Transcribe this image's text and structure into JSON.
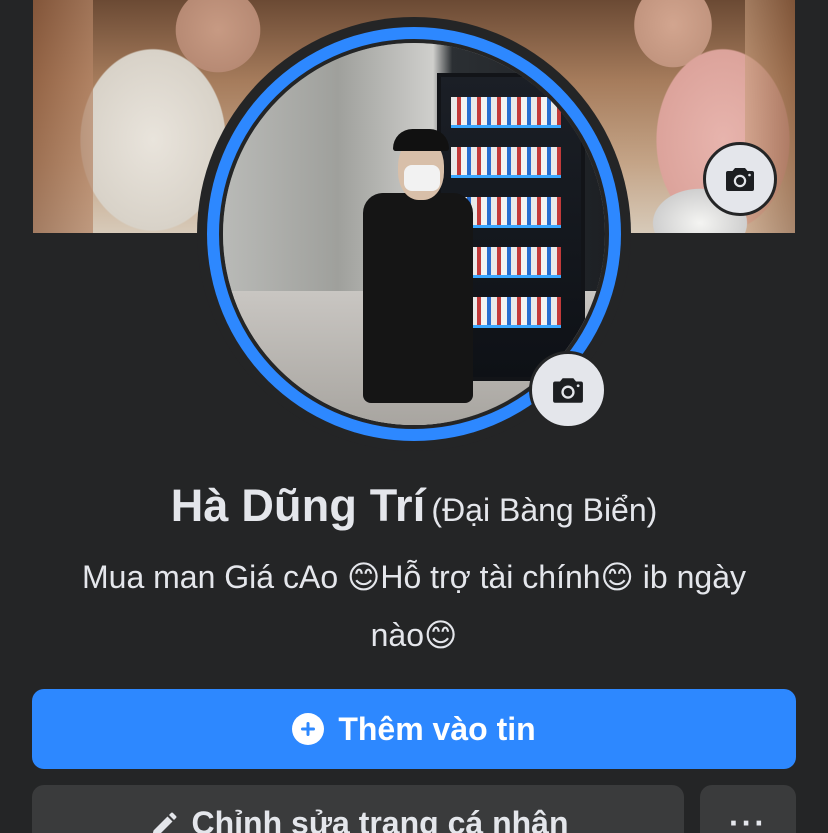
{
  "profile": {
    "name": "Hà Dũng Trí",
    "alternate_name": "(Đại Bàng Biển)",
    "bio_line1": "Mua man Giá cAo 😊Hỗ trợ tài chính😊 ib ngày",
    "bio_line2": "nào😊"
  },
  "actions": {
    "add_story_label": "Thêm vào tin",
    "edit_profile_label": "Chỉnh sửa trang cá nhân",
    "more_label": "···"
  },
  "icons": {
    "cover_camera": "camera-icon",
    "avatar_camera": "camera-icon",
    "add": "plus-circle-icon",
    "edit": "pencil-icon"
  },
  "colors": {
    "background": "#242526",
    "primary": "#2d88ff",
    "secondary_button": "#3a3b3c",
    "text": "#e4e6eb"
  }
}
